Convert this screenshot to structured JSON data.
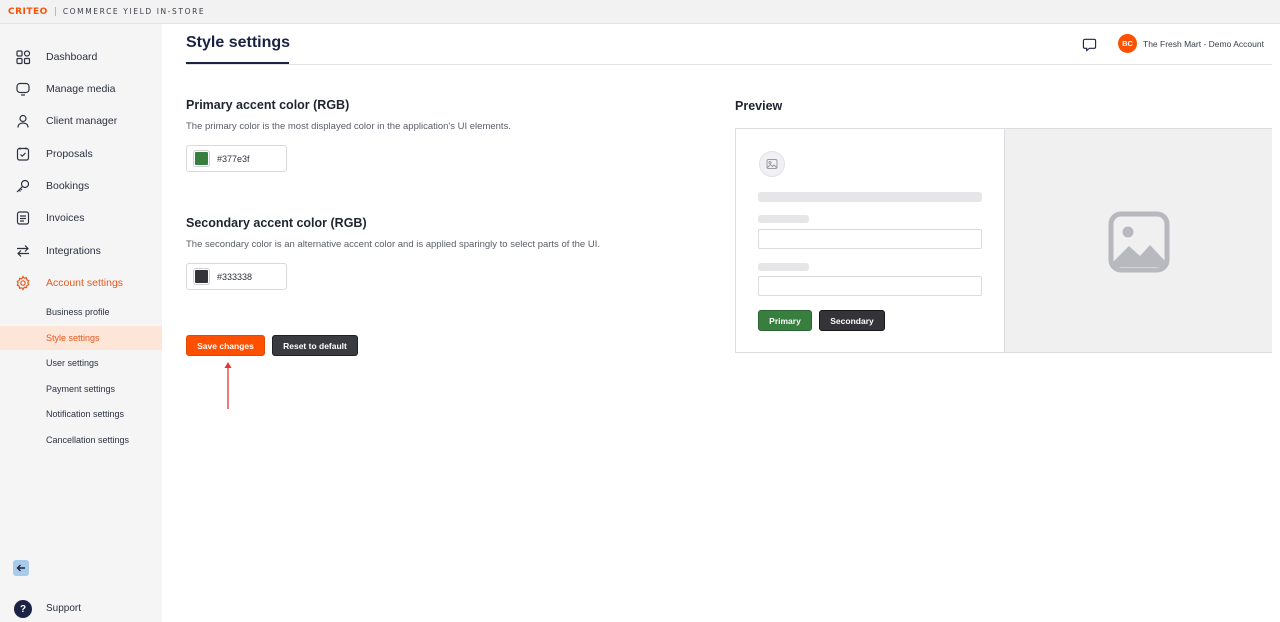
{
  "header": {
    "brand": "CRITEO",
    "product": "COMMERCE YIELD IN-STORE"
  },
  "sidebar": {
    "items": [
      {
        "label": "Dashboard",
        "icon": "dashboard-grid-icon"
      },
      {
        "label": "Manage media",
        "icon": "monitor-icon"
      },
      {
        "label": "Client manager",
        "icon": "user-icon"
      },
      {
        "label": "Proposals",
        "icon": "proposal-icon"
      },
      {
        "label": "Bookings",
        "icon": "key-icon"
      },
      {
        "label": "Invoices",
        "icon": "invoice-icon"
      },
      {
        "label": "Integrations",
        "icon": "arrows-swap-icon"
      },
      {
        "label": "Account settings",
        "icon": "gear-icon",
        "active": true
      }
    ],
    "sub_items": [
      {
        "label": "Business profile"
      },
      {
        "label": "Style settings",
        "active": true
      },
      {
        "label": "User settings"
      },
      {
        "label": "Payment settings"
      },
      {
        "label": "Notification settings"
      },
      {
        "label": "Cancellation settings"
      }
    ],
    "support_label": "Support",
    "support_badge": "?"
  },
  "page": {
    "title": "Style settings"
  },
  "account": {
    "initials": "BC",
    "name": "The Fresh Mart - Demo Account"
  },
  "primary": {
    "title": "Primary accent color (RGB)",
    "description": "The primary color is the most displayed color in the application's UI elements.",
    "value": "#377e3f"
  },
  "secondary": {
    "title": "Secondary accent color (RGB)",
    "description": "The secondary color is an alternative accent color and is applied sparingly to select parts of the UI.",
    "value": "#333338"
  },
  "actions": {
    "save_label": "Save changes",
    "reset_label": "Reset to default"
  },
  "preview": {
    "title": "Preview",
    "primary_label": "Primary",
    "secondary_label": "Secondary"
  },
  "colors": {
    "brand_orange": "#fe5000",
    "active_text": "#e55a1f",
    "active_bg": "#fde5d8",
    "primary_accent": "#377e3f",
    "secondary_accent": "#333338"
  }
}
